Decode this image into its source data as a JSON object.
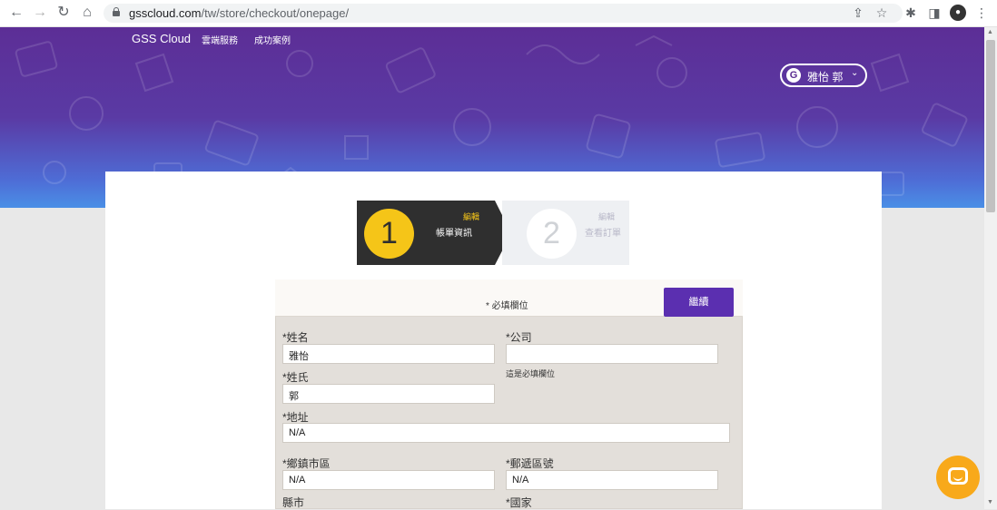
{
  "browser": {
    "url_domain": "gsscloud.com",
    "url_path": "/tw/store/checkout/onepage/"
  },
  "header": {
    "brand": "GSS Cloud",
    "nav": [
      "雲端服務",
      "成功案例"
    ],
    "user_initial": "G",
    "user_name": "雅怡 郭"
  },
  "steps": [
    {
      "number": "1",
      "edit_label": "編輯",
      "title": "帳單資訊",
      "active": true
    },
    {
      "number": "2",
      "edit_label": "編輯",
      "title": "查看訂單",
      "active": false
    }
  ],
  "form": {
    "required_note": "* 必填欄位",
    "continue_label": "繼續",
    "fields": {
      "first_name": {
        "label": "*姓名",
        "value": "雅怡"
      },
      "company": {
        "label": "*公司",
        "value": "",
        "error": "這是必填欄位"
      },
      "last_name": {
        "label": "*姓氏",
        "value": "郭"
      },
      "address": {
        "label": "*地址",
        "value": "N/A"
      },
      "district": {
        "label": "*鄉鎮市區",
        "value": "N/A"
      },
      "postcode": {
        "label": "*郵遞區號",
        "value": "N/A"
      },
      "city": {
        "label": "縣市"
      },
      "country": {
        "label": "*國家"
      }
    }
  },
  "colors": {
    "brand_purple": "#5b2fb0",
    "step_yellow": "#f5c518",
    "chat_orange": "#f8a91a"
  }
}
